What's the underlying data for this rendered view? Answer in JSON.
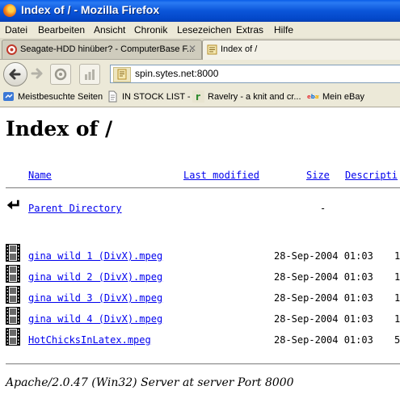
{
  "window": {
    "title": "Index of / - Mozilla Firefox",
    "icon": "firefox-icon"
  },
  "menu": [
    "Datei",
    "Bearbeiten",
    "Ansicht",
    "Chronik",
    "Lesezeichen",
    "Extras",
    "Hilfe"
  ],
  "tabs": [
    {
      "label": "Seagate-HDD hinüber? - ComputerBase F...",
      "active": false,
      "icon": "computerbase-icon"
    },
    {
      "label": "Index of /",
      "active": true,
      "icon": "generic-site-icon"
    }
  ],
  "nav": {
    "url": "spin.sytes.net:8000"
  },
  "bookmarks": [
    {
      "label": "Meistbesuchte Seiten",
      "icon": "most-visited-icon"
    },
    {
      "label": "IN STOCK LIST -",
      "icon": "page-icon"
    },
    {
      "label": "Ravelry - a knit and cr...",
      "icon": "ravelry-icon"
    },
    {
      "label": "Mein eBay",
      "icon": "ebay-icon"
    }
  ],
  "listing": {
    "heading": "Index of /",
    "columns": {
      "name": "Name",
      "modified": "Last modified",
      "size": "Size",
      "description": "Descripti"
    },
    "parent": {
      "label": "Parent Directory",
      "size": "-"
    },
    "files": [
      {
        "name": "gina wild 1 (DivX).mpeg",
        "modified": "28-Sep-2004 01:03",
        "size": "1"
      },
      {
        "name": "gina wild 2 (DivX).mpeg",
        "modified": "28-Sep-2004 01:03",
        "size": "1"
      },
      {
        "name": "gina wild 3 (DivX).mpeg",
        "modified": "28-Sep-2004 01:03",
        "size": "1"
      },
      {
        "name": "gina wild 4 (DivX).mpeg",
        "modified": "28-Sep-2004 01:03",
        "size": "1"
      },
      {
        "name": "HotChicksInLatex.mpeg",
        "modified": "28-Sep-2004 01:03",
        "size": "5"
      }
    ],
    "address": "Apache/2.0.47 (Win32) Server at server Port 8000"
  },
  "colors": {
    "titlebar": "#0b55d9",
    "chrome": "#ece9d8",
    "link": "#0000ee"
  }
}
